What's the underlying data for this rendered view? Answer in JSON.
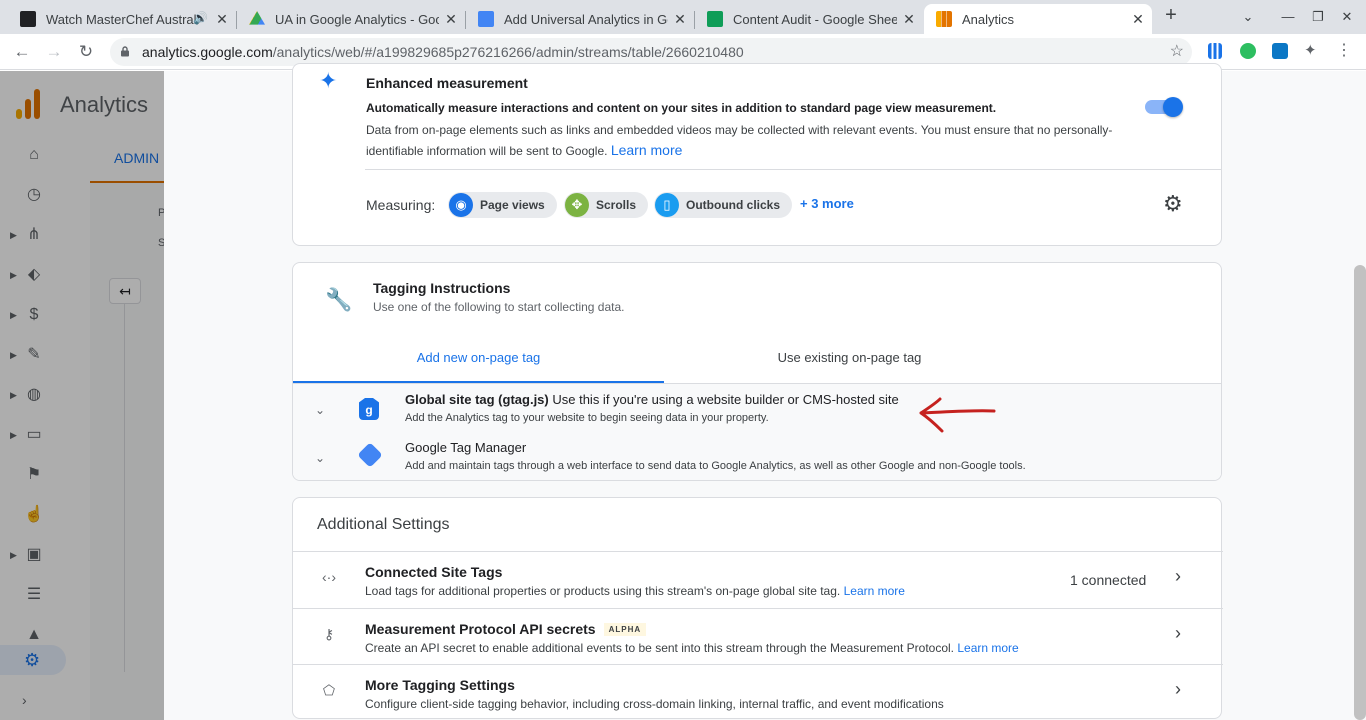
{
  "browser": {
    "tabs": [
      {
        "title": "Watch MasterChef Austral",
        "favicon_color": "#202124"
      },
      {
        "title": "UA in Google Analytics - Goog",
        "favicon_color": "#34a853"
      },
      {
        "title": "Add Universal Analytics in Goo",
        "favicon_color": "#4285f4"
      },
      {
        "title": "Content Audit - Google Sheets",
        "favicon_color": "#0f9d58"
      },
      {
        "title": "Analytics",
        "favicon_color": "#f9ab00"
      }
    ],
    "url_host": "analytics.google.com",
    "url_path": "/analytics/web/#/a199829685p276216266/admin/streams/table/2660210480"
  },
  "ga": {
    "title": "Analytics",
    "admin_tab": "ADMIN",
    "crumb_p": "P",
    "crumb_s": "S"
  },
  "enhanced": {
    "title": "Enhanced measurement",
    "lead": "Automatically measure interactions and content on your sites in addition to standard page view measurement.",
    "body": "Data from on-page elements such as links and embedded videos may be collected with relevant events. You must ensure that no personally-identifiable information will be sent to Google.",
    "learn_more": "Learn more",
    "measuring_label": "Measuring:",
    "chips": [
      {
        "label": "Page views",
        "color": "#1a73e8"
      },
      {
        "label": "Scrolls",
        "color": "#7cb342"
      },
      {
        "label": "Outbound clicks",
        "color": "#1a9cf0"
      }
    ],
    "more": "+ 3 more",
    "enabled": true
  },
  "tagging": {
    "title": "Tagging Instructions",
    "subtitle": "Use one of the following to start collecting data.",
    "tab_new": "Add new on-page tag",
    "tab_existing": "Use existing on-page tag",
    "gtag_title": "Global site tag (gtag.js)",
    "gtag_suffix": " Use this if you're using a website builder or CMS-hosted site",
    "gtag_desc": "Add the Analytics tag to your website to begin seeing data in your property.",
    "gtm_title": "Google Tag Manager",
    "gtm_desc": "Add and maintain tags through a web interface to send data to Google Analytics, as well as other Google and non-Google tools."
  },
  "additional": {
    "title": "Additional Settings",
    "rows": [
      {
        "title": "Connected Site Tags",
        "desc": "Load tags for additional properties or products using this stream's on-page global site tag.",
        "link": "Learn more",
        "value": "1 connected"
      },
      {
        "title": "Measurement Protocol API secrets",
        "badge": "ALPHA",
        "desc": "Create an API secret to enable additional events to be sent into this stream through the Measurement Protocol.",
        "link": "Learn more"
      },
      {
        "title": "More Tagging Settings",
        "desc": "Configure client-side tagging behavior, including cross-domain linking, internal traffic, and event modifications"
      }
    ]
  },
  "colors": {
    "accent": "#1a73e8",
    "annotation": "#c5221f"
  }
}
